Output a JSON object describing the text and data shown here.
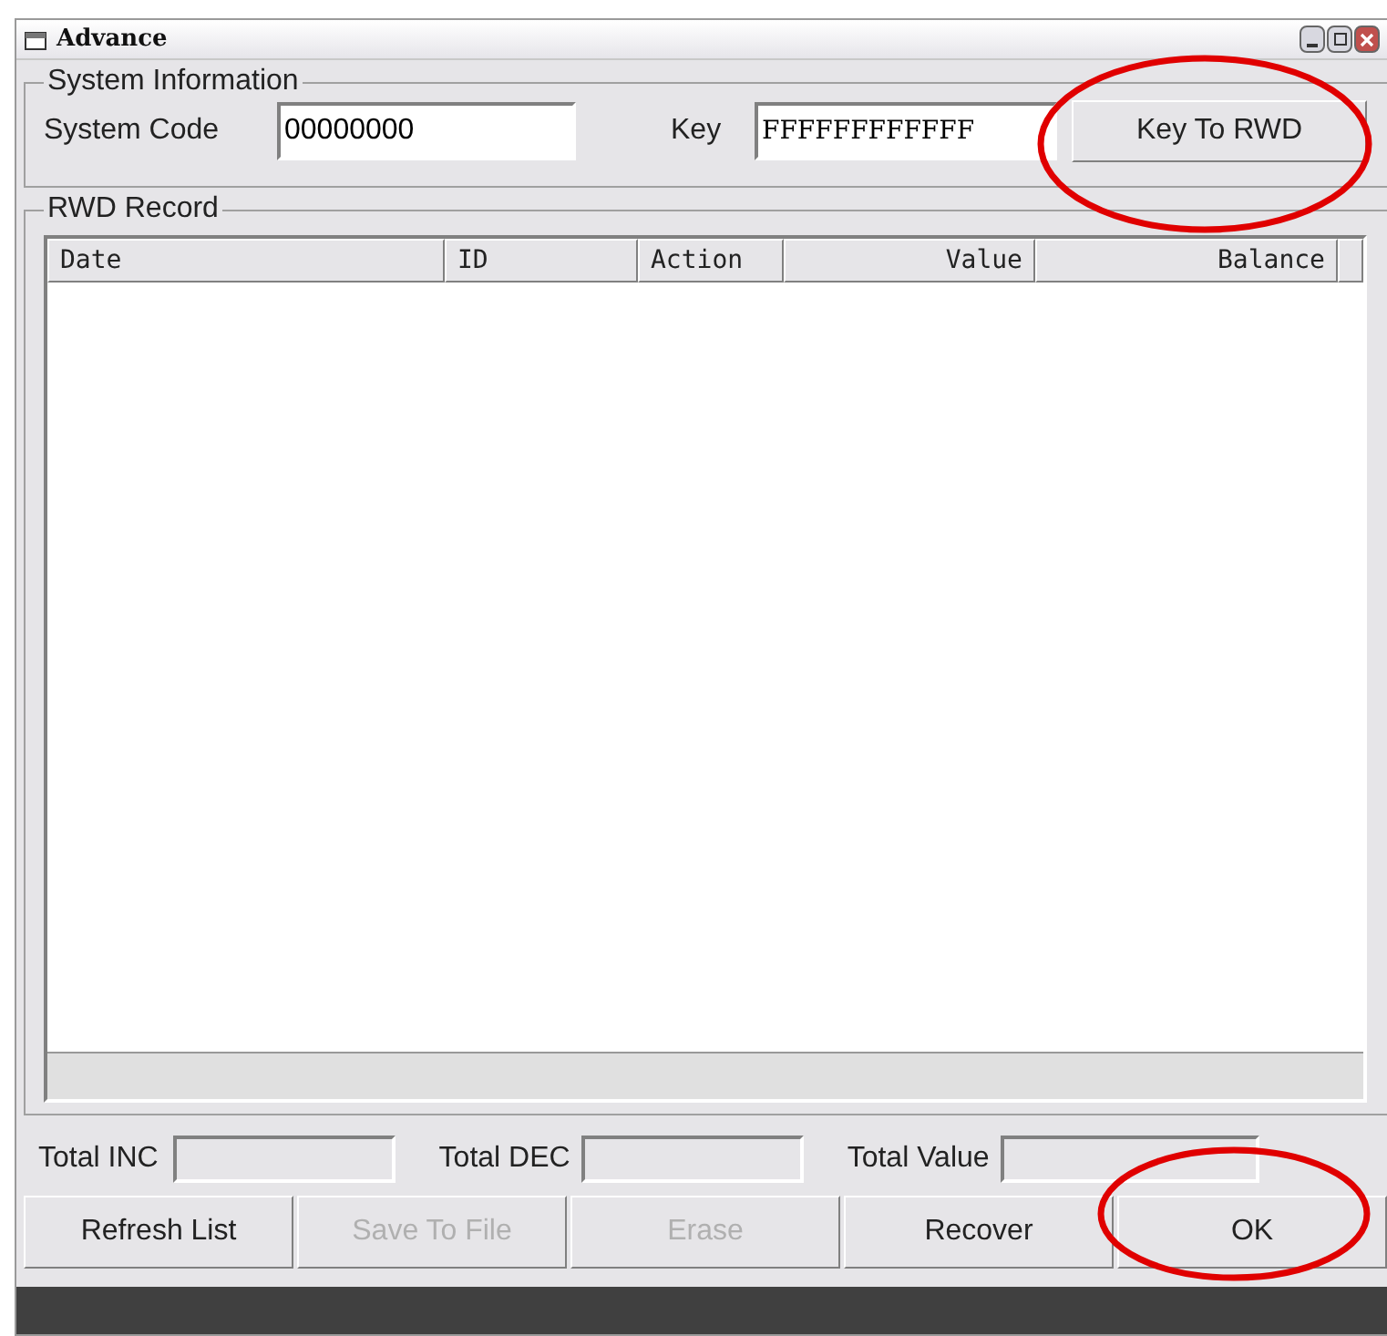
{
  "window": {
    "title": "Advance"
  },
  "system_information": {
    "title": "System Information",
    "system_code_label": "System Code",
    "system_code": "00000000",
    "key_label": "Key",
    "key": "FFFFFFFFFFFF",
    "key_button": "Key To RWD"
  },
  "record": {
    "title": "RWD Record",
    "columns": [
      {
        "label": "Date",
        "kind": "text"
      },
      {
        "label": "ID",
        "kind": "text"
      },
      {
        "label": "Action",
        "kind": "text"
      },
      {
        "label": "Value",
        "kind": "number"
      },
      {
        "label": "Balance",
        "kind": "number"
      }
    ]
  },
  "totals": [
    {
      "label": "Total INC"
    },
    {
      "label": "Total DEC"
    },
    {
      "label": "Total Value"
    }
  ],
  "buttons": [
    {
      "label": "Refresh List",
      "disabled": false
    },
    {
      "label": "Save To File",
      "disabled": true
    },
    {
      "label": "Erase",
      "disabled": true
    },
    {
      "label": "Recover",
      "disabled": false
    },
    {
      "label": "OK",
      "disabled": false
    }
  ]
}
